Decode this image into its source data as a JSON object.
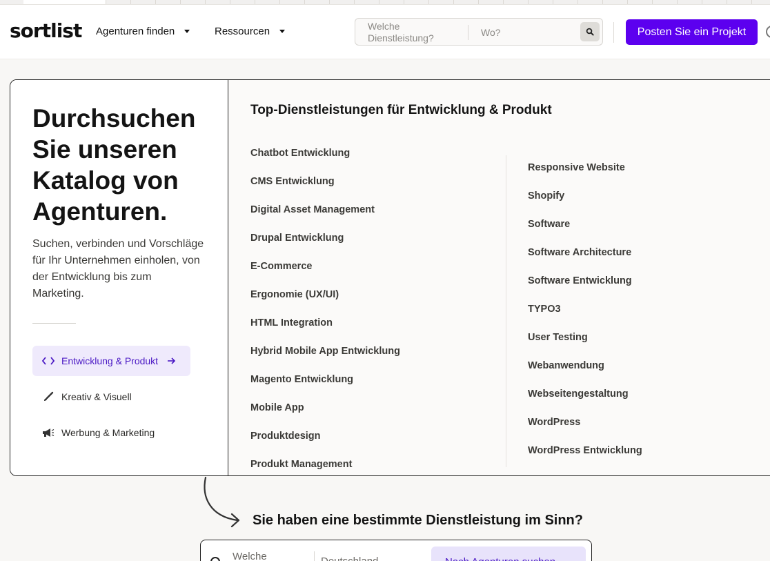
{
  "header": {
    "logo": "sortlist",
    "nav": [
      {
        "label": "Agenturen finden"
      },
      {
        "label": "Ressourcen"
      }
    ],
    "search": {
      "what_placeholder": "Welche Dienstleistung?",
      "where_placeholder": "Wo?"
    },
    "cta_label": "Posten Sie ein Projekt"
  },
  "panel": {
    "headline": "Durchsuchen Sie unseren Katalog von Agenturen.",
    "lead": "Suchen, verbinden und Vorschläge für Ihr Unternehmen einholen, von der Entwicklung bis zum Marketing.",
    "categories": [
      {
        "label": "Entwicklung & Produkt",
        "icon": "code-icon",
        "active": true
      },
      {
        "label": "Kreativ & Visuell",
        "icon": "brush-icon",
        "active": false
      },
      {
        "label": "Werbung & Marketing",
        "icon": "megaphone-icon",
        "active": false
      }
    ],
    "section_title": "Top-Dienstleistungen für Entwicklung & Produkt",
    "services_left": [
      "Chatbot Entwicklung",
      "CMS Entwicklung",
      "Digital Asset Management",
      "Drupal Entwicklung",
      "E-Commerce",
      "Ergonomie (UX/UI)",
      "HTML Integration",
      "Hybrid Mobile App Entwicklung",
      "Magento Entwicklung",
      "Mobile App",
      "Produktdesign",
      "Produkt Management"
    ],
    "services_right": [
      "Responsive Website",
      "Shopify",
      "Software",
      "Software Architecture",
      "Software Entwicklung",
      "TYPO3",
      "User Testing",
      "Webanwendung",
      "Webseitengestaltung",
      "WordPress",
      "WordPress Entwicklung"
    ]
  },
  "bottom": {
    "title": "Sie haben eine bestimmte Dienstleistung im Sinn?",
    "what_placeholder": "Welche",
    "where_placeholder": "Deutschland",
    "button_label": "Nach Agenturen suchen"
  },
  "colors": {
    "brand": "#5c00ef",
    "active_bg": "#efeafc",
    "active_text": "#4a18c4"
  }
}
